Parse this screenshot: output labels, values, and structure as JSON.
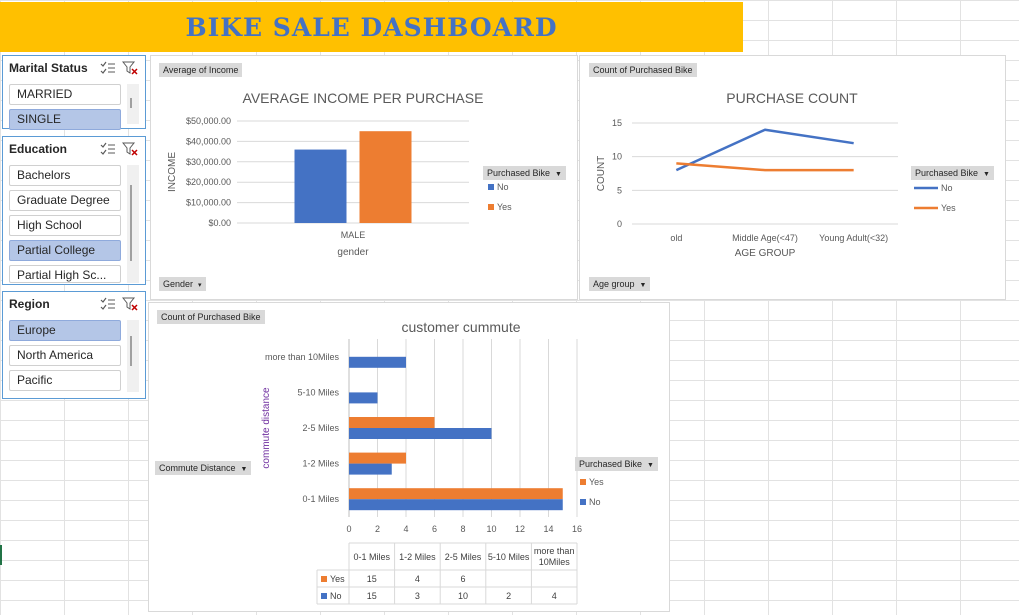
{
  "dashboard": {
    "title": "BIKE SALE DASHBOARD"
  },
  "slicers": {
    "marital": {
      "title": "Marital Status",
      "items": [
        "MARRIED",
        "SINGLE"
      ]
    },
    "education": {
      "title": "Education",
      "items": [
        "Bachelors",
        "Graduate Degree",
        "High School",
        "Partial College",
        "Partial High Sc..."
      ]
    },
    "region": {
      "title": "Region",
      "items": [
        "Europe",
        "North America",
        "Pacific"
      ]
    }
  },
  "icons": {
    "multiselect": "multi-select-icon",
    "clear": "clear-filter-icon"
  },
  "colors": {
    "no": "#4472c4",
    "yes": "#ed7d31",
    "banner": "#ffc000",
    "selected": "#b4c6e7"
  },
  "panel1": {
    "value_button": "Average of Income",
    "axis_button": "Gender",
    "legend_button": "Purchased Bike",
    "legend_items": [
      "No",
      "Yes"
    ]
  },
  "panel2": {
    "value_button": "Count of Purchased Bike",
    "axis_button": "Age group",
    "legend_button": "Purchased Bike",
    "legend_items": [
      "No",
      "Yes"
    ]
  },
  "panel3": {
    "value_button": "Count of Purchased Bike",
    "axis_button": "Commute Distance",
    "legend_button": "Purchased Bike",
    "legend_items": [
      "Yes",
      "No"
    ],
    "table": {
      "headers": [
        "0-1 Miles",
        "1-2 Miles",
        "2-5 Miles",
        "5-10 Miles",
        "more than 10Miles"
      ],
      "rows": [
        {
          "label": "Yes",
          "cells": [
            "15",
            "4",
            "6",
            "",
            ""
          ]
        },
        {
          "label": "No",
          "cells": [
            "15",
            "3",
            "10",
            "2",
            "4"
          ]
        }
      ]
    }
  },
  "chart_data": [
    {
      "type": "bar",
      "title": "AVERAGE INCOME PER PURCHASE",
      "xlabel": "gender",
      "ylabel": "INCOME",
      "categories": [
        "MALE"
      ],
      "series": [
        {
          "name": "No",
          "values": [
            36000
          ]
        },
        {
          "name": "Yes",
          "values": [
            45000
          ]
        }
      ],
      "ylim": [
        0,
        50000
      ],
      "yticks": [
        "$0.00",
        "$10,000.00",
        "$20,000.00",
        "$30,000.00",
        "$40,000.00",
        "$50,000.00"
      ],
      "grid": true,
      "legend": "right"
    },
    {
      "type": "line",
      "title": "PURCHASE COUNT",
      "xlabel": "AGE GROUP",
      "ylabel": "COUNT",
      "categories": [
        "old",
        "Middle Age(<47)",
        "Young Adult(<32)"
      ],
      "series": [
        {
          "name": "No",
          "values": [
            8,
            14,
            12
          ]
        },
        {
          "name": "Yes",
          "values": [
            9,
            8,
            8
          ]
        }
      ],
      "ylim": [
        0,
        15
      ],
      "yticks": [
        "0",
        "5",
        "10",
        "15"
      ],
      "grid": true,
      "legend": "right"
    },
    {
      "type": "bar",
      "orientation": "horizontal",
      "title": "customer cummute",
      "ylabel": "commute distance",
      "categories": [
        "0-1 Miles",
        "1-2 Miles",
        "2-5 Miles",
        "5-10 Miles",
        "more than 10Miles"
      ],
      "series": [
        {
          "name": "Yes",
          "values": [
            15,
            4,
            6,
            0,
            0
          ]
        },
        {
          "name": "No",
          "values": [
            15,
            3,
            10,
            2,
            4
          ]
        }
      ],
      "xlim": [
        0,
        16
      ],
      "xticks": [
        "0",
        "2",
        "4",
        "6",
        "8",
        "10",
        "12",
        "14",
        "16"
      ],
      "grid": true,
      "legend": "right"
    }
  ]
}
